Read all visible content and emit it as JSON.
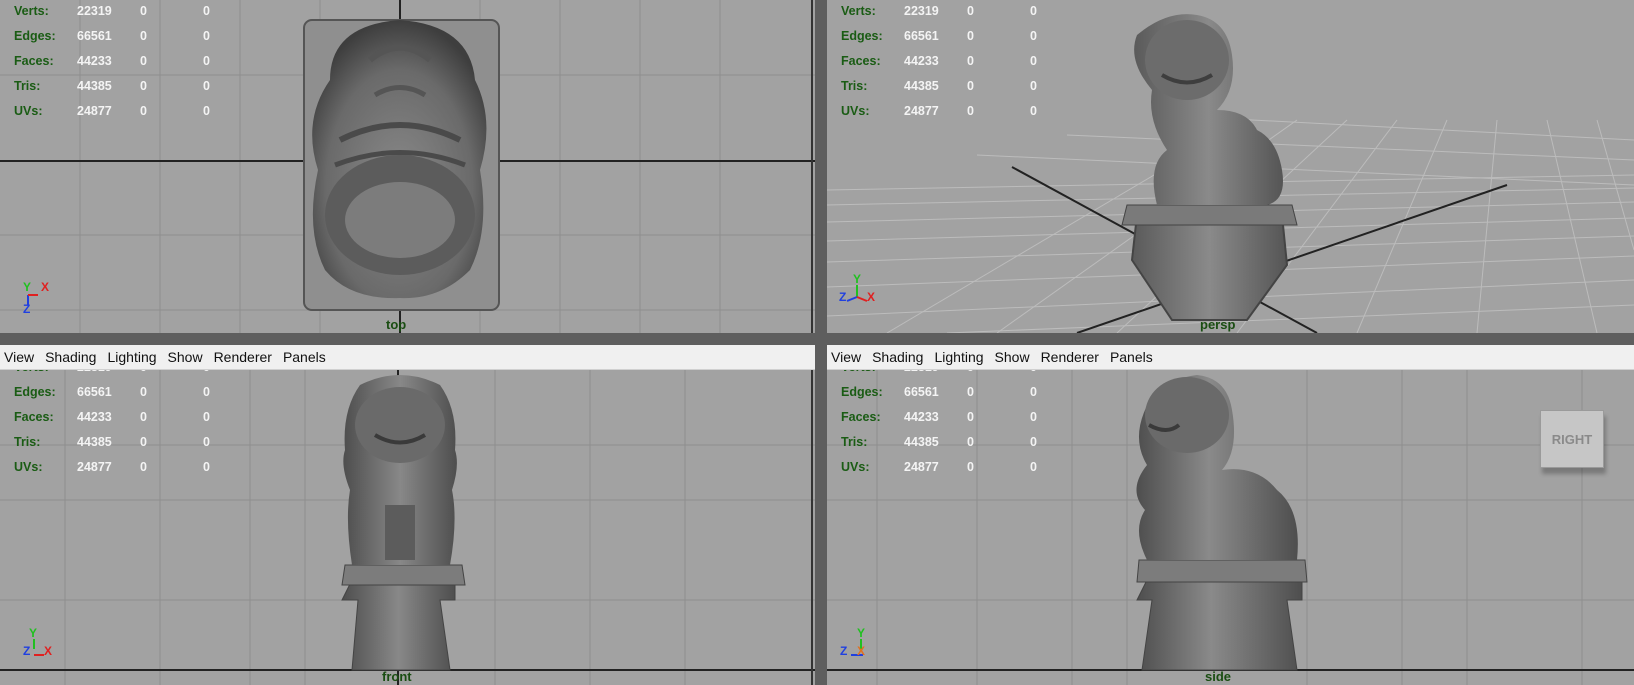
{
  "menu": [
    "View",
    "Shading",
    "Lighting",
    "Show",
    "Renderer",
    "Panels"
  ],
  "hud": [
    {
      "label": "Verts:",
      "values": [
        "22319",
        "0",
        "0"
      ]
    },
    {
      "label": "Edges:",
      "values": [
        "66561",
        "0",
        "0"
      ]
    },
    {
      "label": "Faces:",
      "values": [
        "44233",
        "0",
        "0"
      ]
    },
    {
      "label": "Tris:",
      "values": [
        "44385",
        "0",
        "0"
      ]
    },
    {
      "label": "UVs:",
      "values": [
        "24877",
        "0",
        "0"
      ]
    }
  ],
  "viewports": {
    "top": {
      "camera": "top"
    },
    "persp": {
      "camera": "persp"
    },
    "front": {
      "camera": "front"
    },
    "side": {
      "camera": "side"
    }
  },
  "viewcube": {
    "label": "RIGHT"
  },
  "axes": {
    "x": "X",
    "y": "Y",
    "z": "Z"
  },
  "colors": {
    "viewport_bg": "#a2a2a2",
    "grid": "#8c8c8c",
    "hud_label": "#1a5c14",
    "hud_value": "#f4f4f4",
    "axis_x": "#e02020",
    "axis_y": "#20c020",
    "axis_z": "#2040e0",
    "model": "#6e6e6e"
  }
}
